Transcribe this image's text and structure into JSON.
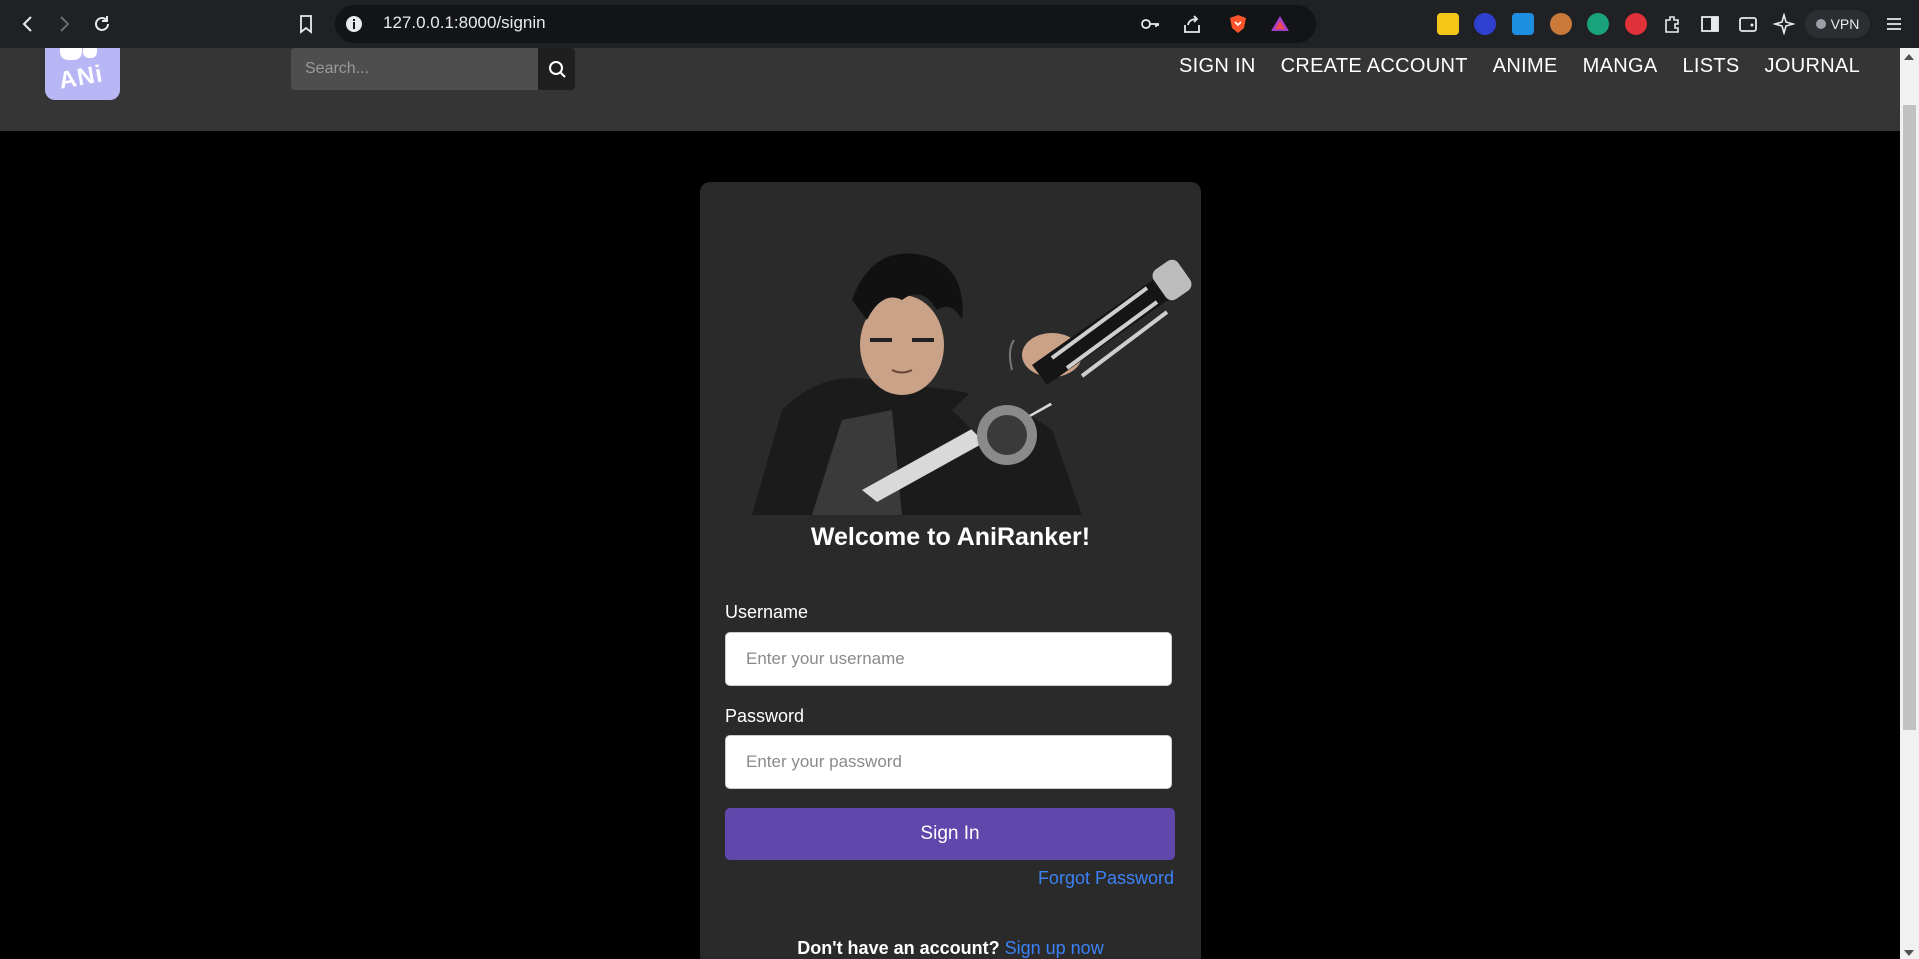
{
  "browser": {
    "url": "127.0.0.1:8000/signin",
    "vpn_label": "VPN",
    "icons": [
      "back-icon",
      "forward-icon",
      "reload-icon",
      "bookmark-icon",
      "info-icon",
      "key-icon",
      "share-icon",
      "brave-shield-icon",
      "brave-rewards-icon",
      "extensions-icon",
      "sidebar-icon",
      "wallet-icon",
      "leo-icon",
      "menu-icon"
    ]
  },
  "site": {
    "logo_text": "ANi",
    "search_placeholder": "Search...",
    "nav": [
      "SIGN IN",
      "CREATE ACCOUNT",
      "ANIME",
      "MANGA",
      "LISTS",
      "JOURNAL"
    ]
  },
  "signin": {
    "welcome": "Welcome to AniRanker!",
    "username_label": "Username",
    "username_placeholder": "Enter your username",
    "password_label": "Password",
    "password_placeholder": "Enter your password",
    "submit_label": "Sign In",
    "forgot_label": "Forgot Password",
    "signup_question": "Don't have an account?",
    "signup_link": "Sign up now"
  },
  "colors": {
    "header_bg": "#353535",
    "card_bg": "#2a2a2a",
    "button_purple": "#5f47ac",
    "link_blue": "#3b82f6",
    "logo_bg": "#b9b6f5"
  }
}
